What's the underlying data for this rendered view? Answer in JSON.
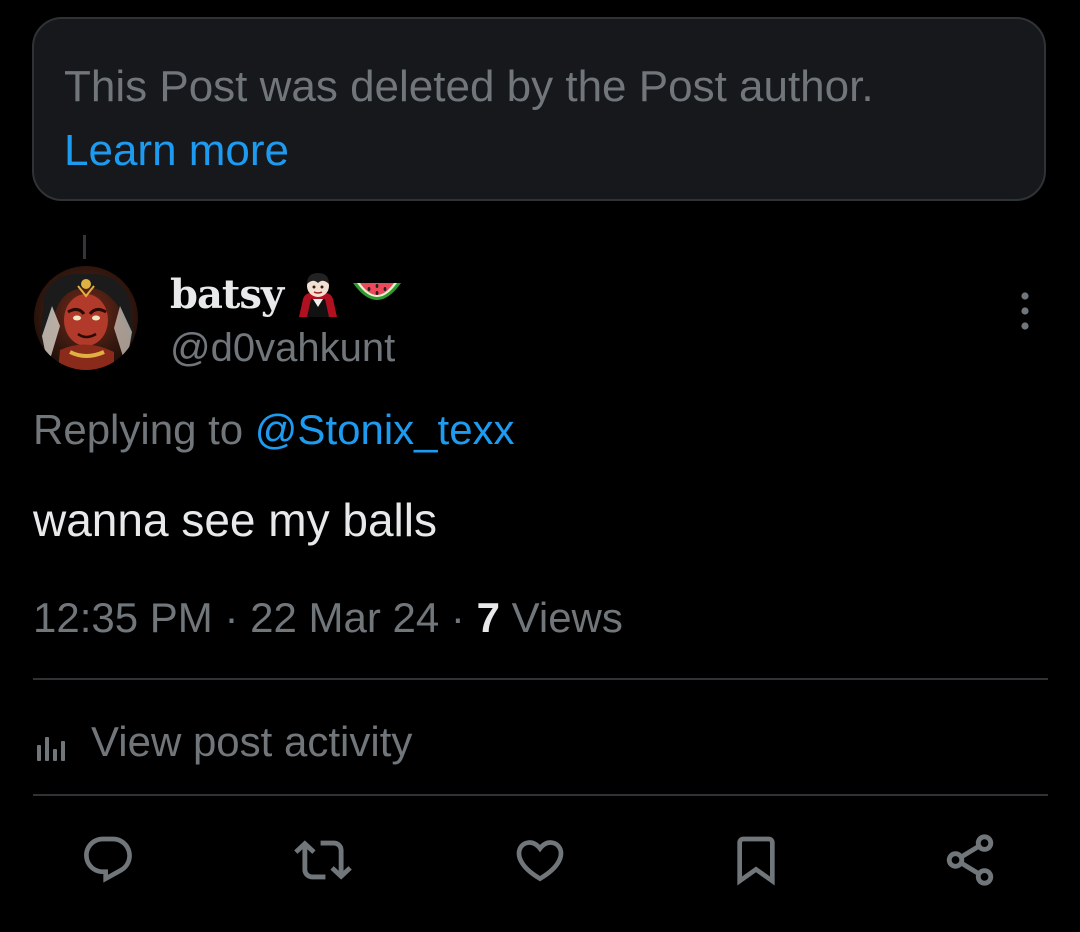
{
  "deleted_notice": {
    "text": "This Post was deleted by the Post author.",
    "link_label": "Learn more"
  },
  "post": {
    "author": {
      "display_name": "batsy",
      "name_emojis": [
        "vampire-emoji",
        "watermelon-emoji"
      ],
      "handle": "@d0vahkunt"
    },
    "replying_prefix": "Replying to",
    "replying_to": "@Stonix_texx",
    "text": "wanna see my balls",
    "time": "12:35 PM",
    "date": "22 Mar 24",
    "separator": "·",
    "views_count": "7",
    "views_label": "Views"
  },
  "activity": {
    "label": "View post activity",
    "icon": "bar-chart-icon"
  },
  "actions": [
    {
      "name": "reply-button",
      "icon": "reply-icon"
    },
    {
      "name": "repost-button",
      "icon": "repost-icon"
    },
    {
      "name": "like-button",
      "icon": "heart-icon"
    },
    {
      "name": "bookmark-button",
      "icon": "bookmark-icon"
    },
    {
      "name": "share-button",
      "icon": "share-icon"
    }
  ],
  "colors": {
    "background": "#000000",
    "card": "#16181c",
    "primary_text": "#e7e9ea",
    "secondary_text": "#71767b",
    "link": "#1d9bf0",
    "divider": "#2f3336"
  }
}
